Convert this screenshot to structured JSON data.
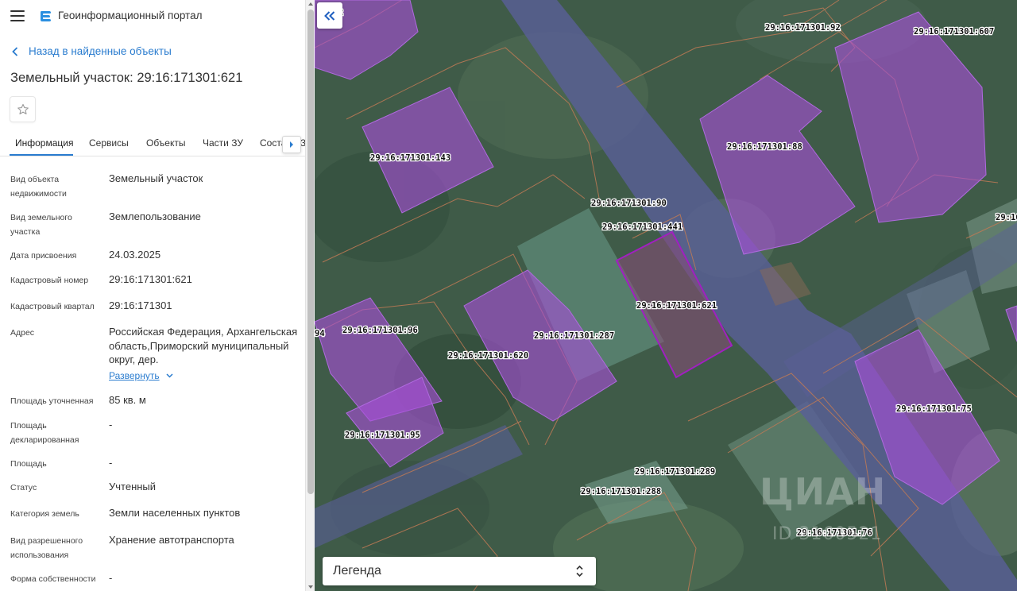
{
  "app": {
    "title": "Геоинформационный портал",
    "back_link": "Назад в найденные объекты",
    "object_title": "Земельный участок: 29:16:171301:621"
  },
  "tabs": [
    {
      "label": "Информация",
      "active": true
    },
    {
      "label": "Сервисы",
      "active": false
    },
    {
      "label": "Объекты",
      "active": false
    },
    {
      "label": "Части ЗУ",
      "active": false
    },
    {
      "label": "Состав ЕЗП",
      "active": false
    }
  ],
  "attributes": [
    {
      "label": "Вид объекта недвижимости",
      "value": "Земельный участок"
    },
    {
      "label": "Вид земельного участка",
      "value": "Землепользование"
    },
    {
      "label": "Дата присвоения",
      "value": "24.03.2025"
    },
    {
      "label": "Кадастровый номер",
      "value": "29:16:171301:621"
    },
    {
      "label": "Кадастровый квартал",
      "value": "29:16:171301"
    },
    {
      "label": "Адрес",
      "value": "Российская Федерация, Архангельская область,Приморский муниципальный округ, дер."
    },
    {
      "label": "Площадь уточненная",
      "value": "85 кв. м"
    },
    {
      "label": "Площадь декларированная",
      "value": "-"
    },
    {
      "label": "Площадь",
      "value": "-"
    },
    {
      "label": "Статус",
      "value": "Учтенный"
    },
    {
      "label": "Категория земель",
      "value": "Земли населенных пунктов"
    },
    {
      "label": "Вид разрешенного использования",
      "value": "Хранение автотранспорта"
    },
    {
      "label": "Форма собственности",
      "value": "-"
    }
  ],
  "expand_label": "Развернуть",
  "map": {
    "legend_label": "Легенда",
    "watermark": "ЦИАН",
    "watermark_id": "ID 3160521",
    "parcel_labels": [
      "29:16:171301:92",
      "29:16:171301:607",
      "29:16:171301:143",
      "29:16:171301:88",
      "29:16:171301:90",
      "29:16:171301:441",
      "29:16:171301:621",
      "29:16:171301:96",
      "29:16:171301:287",
      "29:16:171301:620",
      "29:16:171301:75",
      "29:16:171301:95",
      "29:16:171301:289",
      "29:16:171301:288",
      "29:16:171301:76",
      "2",
      "29:16",
      "94"
    ]
  },
  "colors": {
    "accent": "#2a7ccf",
    "parcel_fill": "#a64fd6",
    "selected_parcel_fill": "#8a4a7a",
    "selected_parcel_outline": "#a020c0",
    "road": "#5a5f9a",
    "parcel_border": "#c07a55"
  }
}
